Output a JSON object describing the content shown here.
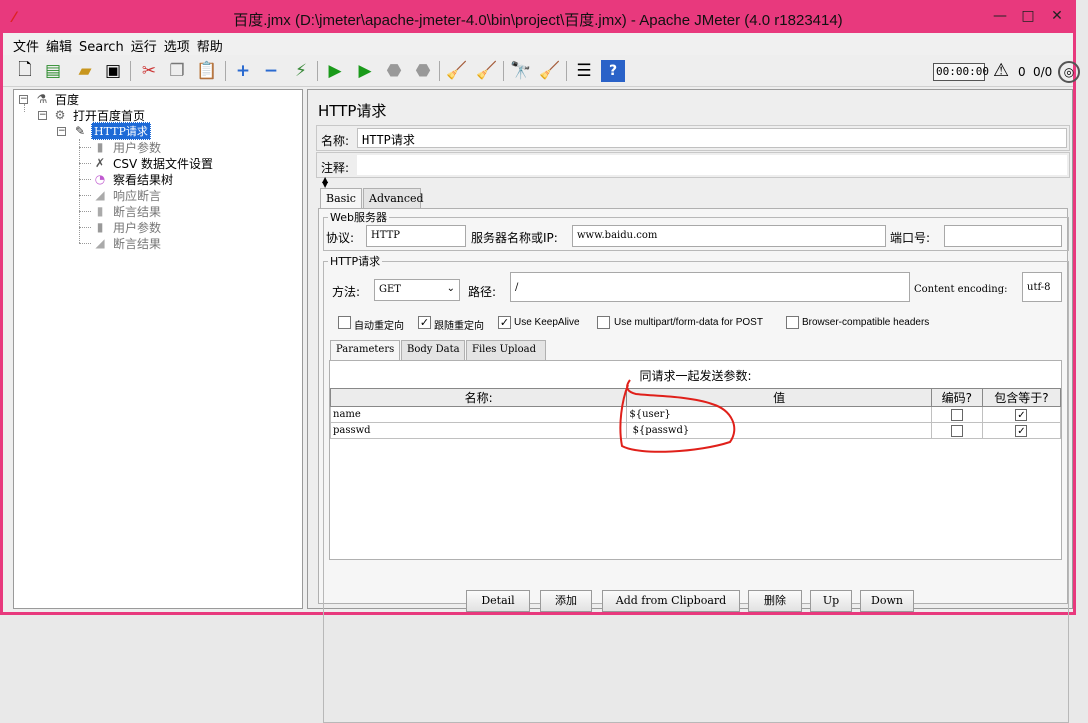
{
  "window": {
    "title": "百度.jmx (D:\\jmeter\\apache-jmeter-4.0\\bin\\project\\百度.jmx) - Apache JMeter (4.0 r1823414)",
    "minimize": "—",
    "maximize": "□",
    "close": "✕"
  },
  "menu": [
    "文件",
    "编辑",
    "Search",
    "运行",
    "选项",
    "帮助"
  ],
  "toolbar": {
    "timer": "00:00:00",
    "warning_count": "0",
    "thread_count": "0/0"
  },
  "tree": {
    "root": "百度",
    "thread_group": "打开百度首页",
    "selected": "HTTP请求",
    "children": [
      "用户参数",
      "CSV 数据文件设置",
      "察看结果树",
      "响应断言",
      "断言结果",
      "用户参数",
      "断言结果"
    ]
  },
  "sampler": {
    "panel_title": "HTTP请求",
    "name_label": "名称:",
    "name_value": "HTTP请求",
    "comment_label": "注释:",
    "comment_value": "",
    "tabs": [
      "Basic",
      "Advanced"
    ],
    "web_server": {
      "group_title": "Web服务器",
      "protocol_label": "协议:",
      "protocol_value": "HTTP",
      "server_label": "服务器名称或IP:",
      "server_value": "www.baidu.com",
      "port_label": "端口号:",
      "port_value": ""
    },
    "http_request": {
      "group_title": "HTTP请求",
      "method_label": "方法:",
      "method_value": "GET",
      "path_label": "路径:",
      "path_value": "/",
      "encoding_label": "Content encoding:",
      "encoding_value": "utf-8"
    },
    "options": [
      {
        "label": "自动重定向",
        "checked": false
      },
      {
        "label": "跟随重定向",
        "checked": true
      },
      {
        "label": "Use KeepAlive",
        "checked": true
      },
      {
        "label": "Use multipart/form-data for POST",
        "checked": false
      },
      {
        "label": "Browser-compatible headers",
        "checked": false
      }
    ],
    "param_tabs": [
      "Parameters",
      "Body Data",
      "Files Upload"
    ],
    "params_caption": "同请求一起发送参数:",
    "columns": [
      "名称:",
      "值",
      "编码?",
      "包含等于?"
    ],
    "rows": [
      {
        "name": "name",
        "value": "${user}",
        "encode": false,
        "include_equals": true
      },
      {
        "name": "passwd",
        "value": " ${passwd}",
        "encode": false,
        "include_equals": true
      }
    ],
    "buttons": [
      "Detail",
      "添加",
      "Add from Clipboard",
      "删除",
      "Up",
      "Down"
    ]
  },
  "colors": {
    "titlebar": "#e8397d",
    "selection": "#1e6ad6",
    "annotation": "#e0201a"
  }
}
